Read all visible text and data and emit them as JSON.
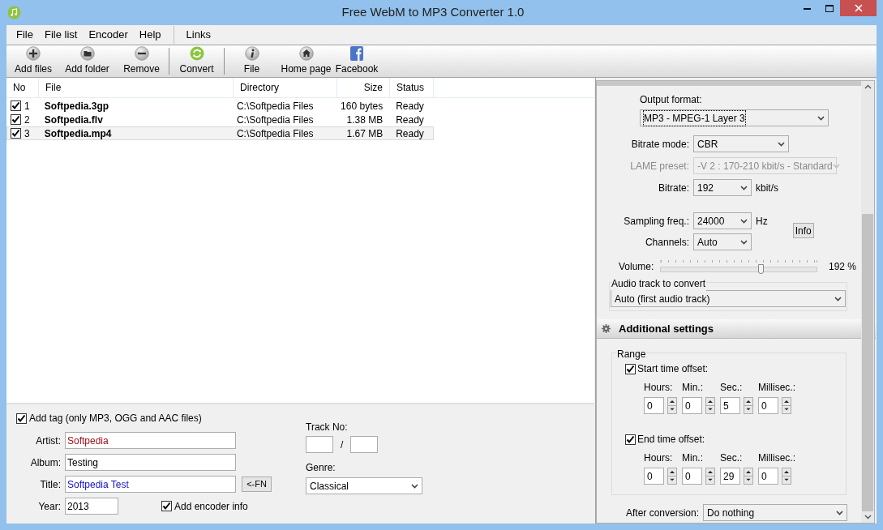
{
  "window": {
    "title": "Free WebM to MP3 Converter 1.0"
  },
  "menu": [
    {
      "label": "File"
    },
    {
      "label": "File list"
    },
    {
      "label": "Encoder"
    },
    {
      "label": "Help"
    },
    {
      "label": "Links"
    }
  ],
  "toolbar": [
    {
      "label": "Add files",
      "kind": "add"
    },
    {
      "label": "Add folder",
      "kind": "folder"
    },
    {
      "label": "Remove",
      "kind": "remove"
    },
    {
      "label": "Convert",
      "kind": "convert"
    },
    {
      "label": "File",
      "kind": "info"
    },
    {
      "label": "Home page",
      "kind": "home"
    },
    {
      "label": "Facebook",
      "kind": "facebook"
    }
  ],
  "file_list": {
    "columns": [
      "No",
      "File",
      "Directory",
      "Size",
      "Status"
    ],
    "rows": [
      {
        "checked": true,
        "no": "1",
        "file": "Softpedia.3gp",
        "directory": "C:\\Softpedia Files",
        "size": "160 bytes",
        "status": "Ready",
        "selected": false
      },
      {
        "checked": true,
        "no": "2",
        "file": "Softpedia.flv",
        "directory": "C:\\Softpedia Files",
        "size": "1.38 MB",
        "status": "Ready",
        "selected": false
      },
      {
        "checked": true,
        "no": "3",
        "file": "Softpedia.mp4",
        "directory": "C:\\Softpedia Files",
        "size": "1.67 MB",
        "status": "Ready",
        "selected": true
      }
    ]
  },
  "tag": {
    "add_tag": {
      "label": "Add tag (only MP3, OGG and AAC files)",
      "checked": true
    },
    "fields": [
      {
        "label": "Artist:",
        "value": "Softpedia",
        "color": "#a0101c"
      },
      {
        "label": "Album:",
        "value": "Testing",
        "color": "#000000"
      },
      {
        "label": "Title:",
        "value": "Softpedia Test",
        "color": "#1414c8"
      }
    ],
    "fn_button": "<-FN",
    "year": {
      "label": "Year:",
      "value": "2013"
    },
    "add_encoder_info": {
      "label": "Add encoder info",
      "checked": true
    },
    "track_no": {
      "label": "Track No:",
      "separator": "/"
    },
    "genre": {
      "label": "Genre:",
      "value": "Classical"
    }
  },
  "encoder": {
    "output_format": {
      "label": "Output format:",
      "value": "MP3 - MPEG-1 Layer 3"
    },
    "bitrate_mode": {
      "label": "Bitrate mode:",
      "value": "CBR"
    },
    "lame_preset": {
      "label": "LAME preset:",
      "value": "-V 2 : 170-210 kbit/s - Standard",
      "disabled": true
    },
    "bitrate": {
      "label": "Bitrate:",
      "value": "192",
      "unit": "kbit/s"
    },
    "sampling": {
      "label": "Sampling freq.:",
      "value": "24000",
      "unit": "Hz"
    },
    "info_button": "Info",
    "channels": {
      "label": "Channels:",
      "value": "Auto"
    },
    "volume": {
      "label": "Volume:",
      "level": 0.64,
      "reading": "192 %"
    },
    "audio_track": {
      "legend": "Audio track to convert",
      "value": "Auto (first audio track)"
    }
  },
  "additional": {
    "title": "Additional settings",
    "range_legend": "Range",
    "offsets": [
      {
        "label": "Start time offset:",
        "checked": true,
        "parts": [
          {
            "label": "Hours:",
            "value": "0"
          },
          {
            "label": "Min.:",
            "value": "0"
          },
          {
            "label": "Sec.:",
            "value": "5"
          },
          {
            "label": "Millisec.:",
            "value": "0"
          }
        ]
      },
      {
        "label": "End time offset:",
        "checked": true,
        "parts": [
          {
            "label": "Hours:",
            "value": "0"
          },
          {
            "label": "Min.:",
            "value": "0"
          },
          {
            "label": "Sec.:",
            "value": "29"
          },
          {
            "label": "Millisec.:",
            "value": "0"
          }
        ]
      }
    ],
    "after_conversion": {
      "label": "After conversion:",
      "value": "Do nothing"
    }
  }
}
